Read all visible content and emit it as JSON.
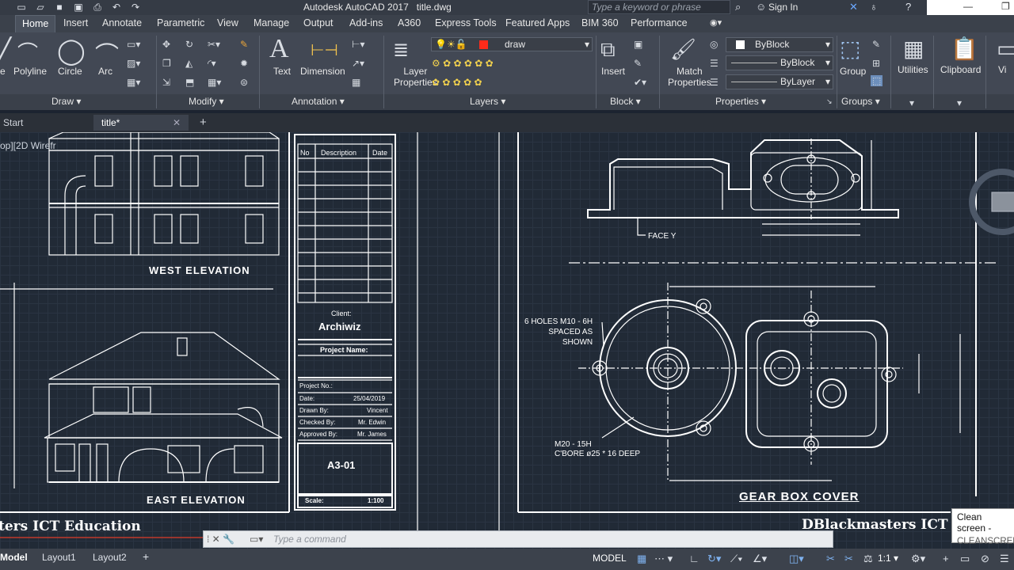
{
  "app": {
    "title": "Autodesk AutoCAD 2017",
    "file": "title.dwg",
    "search_placeholder": "Type a keyword or phrase",
    "sign_in": "Sign In"
  },
  "ribbon_tabs": [
    "Home",
    "Insert",
    "Annotate",
    "Parametric",
    "View",
    "Manage",
    "Output",
    "Add-ins",
    "A360",
    "Express Tools",
    "Featured Apps",
    "BIM 360",
    "Performance"
  ],
  "tools": {
    "line": "e",
    "polyline": "Polyline",
    "circle": "Circle",
    "arc": "Arc",
    "text": "Text",
    "dimension": "Dimension",
    "layer_properties": [
      "Layer",
      "Properties"
    ],
    "insert": "Insert",
    "match_properties": [
      "Match",
      "Properties"
    ],
    "group": "Group",
    "utilities": "Utilities",
    "clipboard": "Clipboard",
    "view": "Vi"
  },
  "layer": {
    "current": "draw",
    "color": "#ff2b1a"
  },
  "properties": {
    "color": "ByBlock",
    "linetype": "ByBlock",
    "lineweight": "ByLayer"
  },
  "panels": [
    "Draw",
    "Modify",
    "Annotation",
    "Layers",
    "Block",
    "Properties",
    "Groups"
  ],
  "doc_tabs": {
    "start": "Start",
    "current": "title*"
  },
  "viewport_label": "op][2D Wirefr",
  "drawing": {
    "west_elevation": "WEST  ELEVATION",
    "east_elevation": "EAST  ELEVATION",
    "gear_box": "GEAR BOX COVER",
    "face_label": "FACE Y",
    "holes_note": [
      "6 HOLES M10 - 6H",
      "SPACED AS",
      "SHOWN"
    ],
    "bore_note": [
      "M20 - 15H",
      "C'BORE ø25 * 16 DEEP"
    ],
    "brand_left": "ters ICT Education",
    "brand_right": "DBlackmasters ICT Edu"
  },
  "titleblock": {
    "headers": [
      "No",
      "Description",
      "Date"
    ],
    "client_label": "Client:",
    "client": "Archiwiz",
    "project_name_label": "Project Name:",
    "project_no_label": "Project No.:",
    "date_label": "Date:",
    "date": "25/04/2019",
    "drawn_by_label": "Drawn By:",
    "drawn_by": "Vincent",
    "checked_by_label": "Checked By:",
    "checked_by": "Mr. Edwin",
    "approved_by_label": "Approved By:",
    "approved_by": "Mr. James",
    "sheet": "A3-01",
    "scale_label": "Scale:",
    "scale": "1:100"
  },
  "command_line": {
    "placeholder": "Type a command"
  },
  "tooltip": {
    "title": "Clean screen -",
    "command": "CLEANSCREE"
  },
  "status": {
    "layout_tabs": [
      "Model",
      "Layout1",
      "Layout2"
    ],
    "model": "MODEL",
    "scale": "1:1"
  }
}
